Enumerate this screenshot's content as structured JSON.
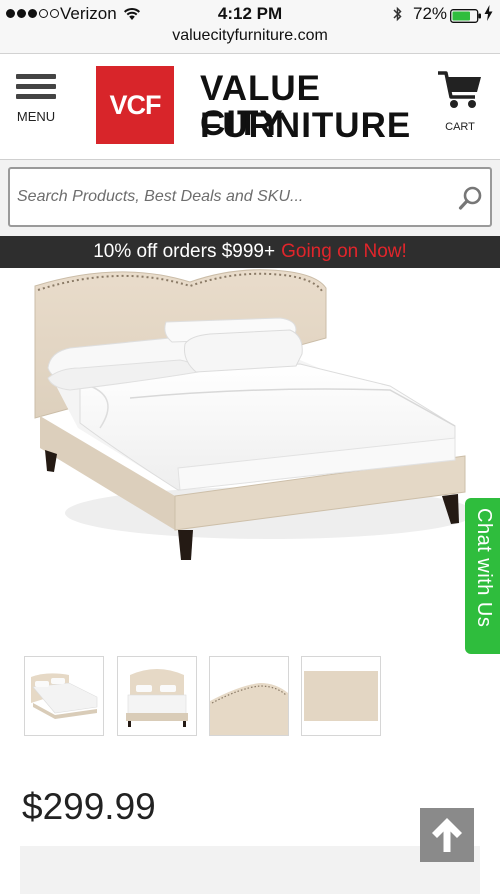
{
  "status_bar": {
    "carrier": "Verizon",
    "time": "4:12 PM",
    "battery": "72%",
    "url": "valuecityfurniture.com",
    "icons": [
      "signal-dots-icon",
      "wifi-icon",
      "bluetooth-icon",
      "battery-icon",
      "charging-icon"
    ]
  },
  "header": {
    "menu_label": "MENU",
    "logo_mark": "VCF",
    "logo_line1": "VALUE CITY",
    "logo_line2": "FURNITURE",
    "cart_label": "CART"
  },
  "search": {
    "placeholder": "Search Products, Best Deals and SKU..."
  },
  "promo": {
    "text": "10% off orders $999+",
    "highlight": "Going on Now!"
  },
  "chat": {
    "label": "Chat with Us"
  },
  "product": {
    "price": "$299.99"
  },
  "colors": {
    "brand_red": "#d8252a",
    "promo_bar": "#2e2e2e",
    "promo_highlight": "#e0252b",
    "chat_green": "#2fbd3d",
    "upholstery": "#e6d9c6"
  }
}
